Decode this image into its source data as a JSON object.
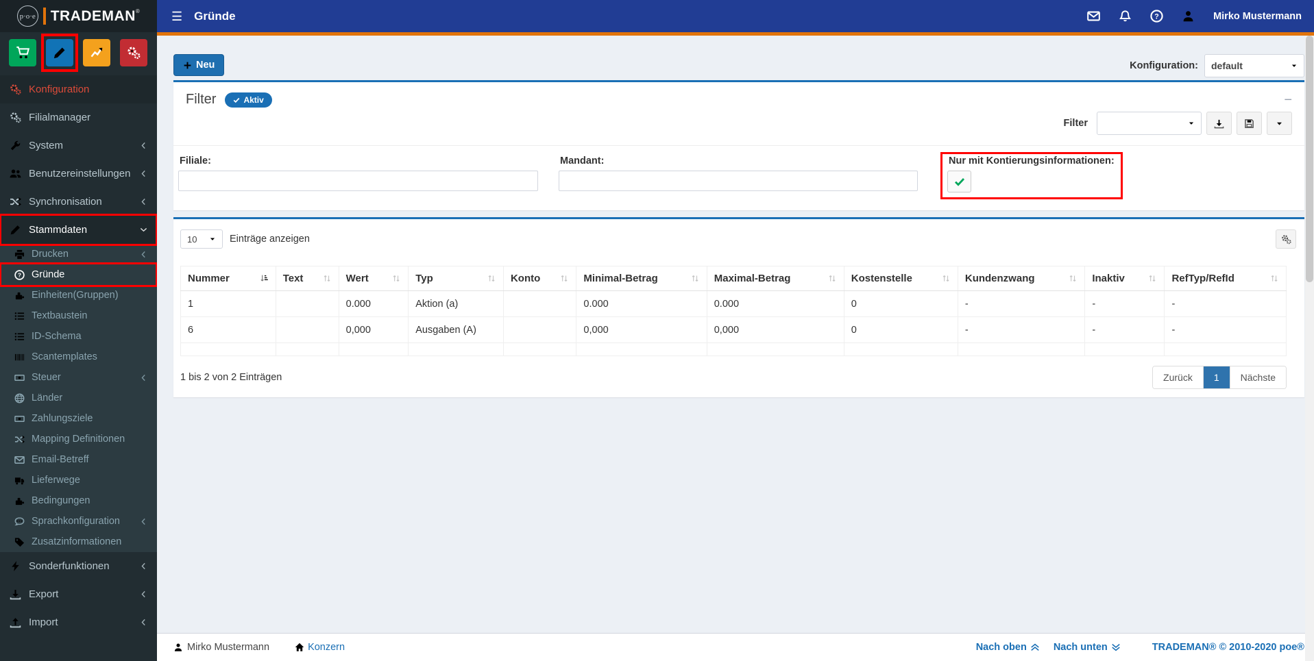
{
  "brand": {
    "circle_text": "p·o·e",
    "name": "TRADEMAN",
    "registered": "®"
  },
  "quick_buttons": [
    {
      "icon": "cart-icon",
      "color": "#00a65a"
    },
    {
      "icon": "pencil-icon",
      "color": "#1173b6",
      "annotated": true
    },
    {
      "icon": "chart-line-icon",
      "color": "#f4a11d"
    },
    {
      "icon": "gears-icon",
      "color": "#c22d33"
    }
  ],
  "topbar": {
    "title": "Gründe",
    "user": "Mirko Mustermann",
    "icons": [
      "envelope-icon",
      "bell-icon",
      "question-circle-icon",
      "user-icon"
    ]
  },
  "sidebar": {
    "top": [
      {
        "label": "Konfiguration",
        "icon": "gears",
        "highlight": "red"
      },
      {
        "label": "Filialmanager",
        "icon": "gears"
      },
      {
        "label": "System",
        "icon": "wrench",
        "chevron": "left"
      },
      {
        "label": "Benutzereinstellungen",
        "icon": "users",
        "chevron": "left"
      },
      {
        "label": "Synchronisation",
        "icon": "shuffle",
        "chevron": "left"
      },
      {
        "label": "Stammdaten",
        "icon": "pencil",
        "chevron": "down",
        "active": true,
        "annotated": true
      }
    ],
    "sub": [
      {
        "label": "Drucken",
        "icon": "printer",
        "chevron": "left"
      },
      {
        "label": "Gründe",
        "icon": "question-circle",
        "active": true,
        "annotated": true
      },
      {
        "label": "Einheiten(Gruppen)",
        "icon": "puzzle"
      },
      {
        "label": "Textbaustein",
        "icon": "list"
      },
      {
        "label": "ID-Schema",
        "icon": "list"
      },
      {
        "label": "Scantemplates",
        "icon": "barcode"
      },
      {
        "label": "Steuer",
        "icon": "money",
        "chevron": "left"
      },
      {
        "label": "Länder",
        "icon": "globe"
      },
      {
        "label": "Zahlungsziele",
        "icon": "money"
      },
      {
        "label": "Mapping Definitionen",
        "icon": "shuffle"
      },
      {
        "label": "Email-Betreff",
        "icon": "envelope"
      },
      {
        "label": "Lieferwege",
        "icon": "truck"
      },
      {
        "label": "Bedingungen",
        "icon": "puzzle"
      },
      {
        "label": "Sprachkonfiguration",
        "icon": "comment",
        "chevron": "left"
      },
      {
        "label": "Zusatzinformationen",
        "icon": "tags"
      }
    ],
    "bottom": [
      {
        "label": "Sonderfunktionen",
        "icon": "bolt",
        "chevron": "left"
      },
      {
        "label": "Export",
        "icon": "download",
        "chevron": "left"
      },
      {
        "label": "Import",
        "icon": "upload",
        "chevron": "left"
      }
    ]
  },
  "actions": {
    "new_label": "Neu",
    "config_label": "Konfiguration:",
    "config_value": "default"
  },
  "filter": {
    "heading": "Filter",
    "badge": "Aktiv",
    "collapse": "−",
    "select_label": "Filter",
    "select_value": "",
    "fields": {
      "filiale": "Filiale:",
      "mandant": "Mandant:",
      "kontierung": "Nur mit Kontierungsinformationen:",
      "kontierung_checked": true
    }
  },
  "table": {
    "length_value": "10",
    "length_label": "Einträge anzeigen",
    "columns": [
      {
        "label": "Nummer",
        "sort": "active"
      },
      {
        "label": "Text"
      },
      {
        "label": "Wert"
      },
      {
        "label": "Typ"
      },
      {
        "label": "Konto"
      },
      {
        "label": "Minimal-Betrag"
      },
      {
        "label": "Maximal-Betrag"
      },
      {
        "label": "Kostenstelle"
      },
      {
        "label": "Kundenzwang"
      },
      {
        "label": "Inaktiv"
      },
      {
        "label": "RefTyp/RefId"
      }
    ],
    "rows": [
      [
        "1",
        "",
        "0.000",
        "Aktion (a)",
        "",
        "0.000",
        "0.000",
        "0",
        "-",
        "-",
        "-"
      ],
      [
        "6",
        "",
        "0,000",
        "Ausgaben (A)",
        "",
        "0,000",
        "0,000",
        "0",
        "-",
        "-",
        "-"
      ]
    ],
    "info": "1 bis 2 von 2 Einträgen",
    "pagination": {
      "prev": "Zurück",
      "current": "1",
      "next": "Nächste"
    }
  },
  "footer": {
    "user": "Mirko Mustermann",
    "company": "Konzern",
    "scroll_up": "Nach oben",
    "scroll_down": "Nach unten",
    "copyright": "TRADEMAN® © 2010-2020 poe®"
  },
  "colors": {
    "topbar_blue": "#213d94",
    "accent_orange": "#e1740b",
    "sidebar_dark": "#222d32",
    "submenu_dark": "#2c3b41",
    "accent_blue": "#1a6fb5",
    "btn_green": "#00a65a",
    "btn_blue": "#1173b6",
    "btn_yellow": "#f4a11d",
    "btn_red": "#c22d33",
    "active_red_text": "#dd4b39",
    "annotation_red": "#ff0000",
    "check_green": "#00a65a",
    "content_bg": "#ecf0f5"
  }
}
